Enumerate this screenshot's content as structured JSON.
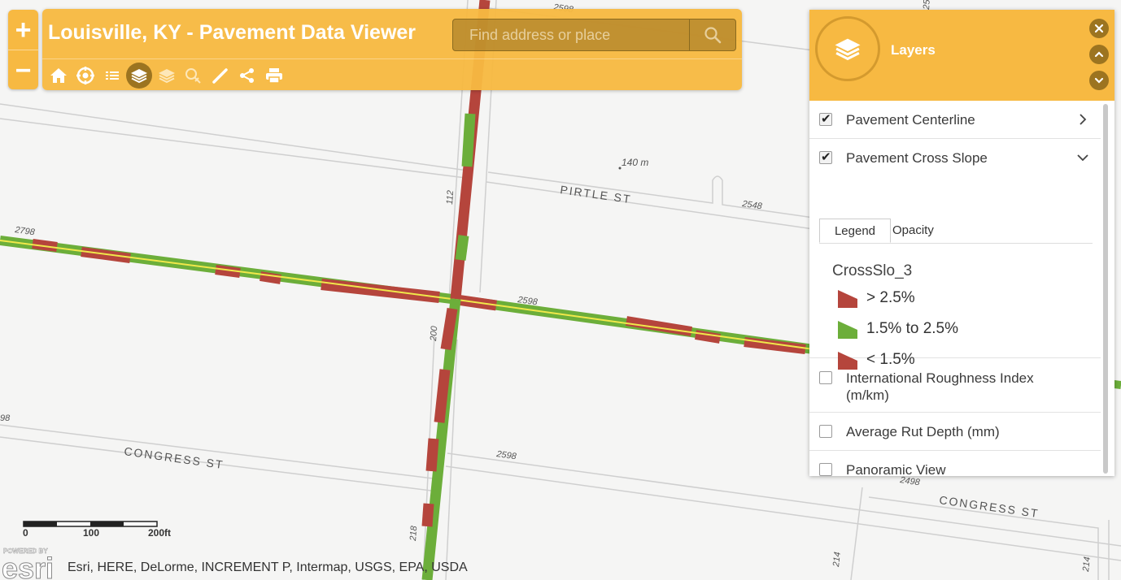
{
  "header": {
    "title": "Louisville, KY - Pavement Data Viewer",
    "search_placeholder": "Find address or place"
  },
  "zoom": {
    "in_label": "+",
    "out_label": "−"
  },
  "toolbar": {
    "tools": [
      "home-icon",
      "locate-icon",
      "list-icon",
      "layers-icon",
      "basemap-icon",
      "bookmark-icon",
      "measure-icon",
      "share-icon",
      "print-icon"
    ],
    "active_tool": "layers-icon"
  },
  "layers_panel": {
    "title": "Layers",
    "layers": [
      {
        "label": "Pavement Centerline",
        "checked": true,
        "expanded": false
      },
      {
        "label": "Pavement Cross Slope",
        "checked": true,
        "expanded": true
      },
      {
        "label": "International Roughness Index (m/km)",
        "checked": false,
        "expanded": false
      },
      {
        "label": "Average Rut Depth (mm)",
        "checked": false,
        "expanded": false
      },
      {
        "label": "Panoramic View",
        "checked": false,
        "expanded": false
      }
    ],
    "tabs": [
      "Legend",
      "Opacity"
    ],
    "active_tab": "Legend",
    "legend": {
      "field": "CrossSlo_3",
      "items": [
        {
          "label": "> 2.5%",
          "color": "#b5453c"
        },
        {
          "label": "1.5% to 2.5%",
          "color": "#6cae3a"
        },
        {
          "label": "< 1.5%",
          "color": "#b5453c"
        }
      ]
    }
  },
  "map": {
    "street_labels": [
      "PIRTLE ST",
      "CONGRESS ST",
      "CONGRESS ST"
    ],
    "address_labels": [
      "2798",
      "2598",
      "2548",
      "2598",
      "2598",
      "2498",
      "112",
      "200",
      "218",
      "214",
      "214",
      "98",
      "2598"
    ],
    "distance_label": "140 m",
    "colors": {
      "high": "#b5453c",
      "mid": "#6cae3a",
      "centerline": "#f0e84a",
      "accent": "#f7b942"
    }
  },
  "scalebar": {
    "labels": [
      "0",
      "100",
      "200ft"
    ]
  },
  "attribution": {
    "powered_by": "POWERED BY",
    "brand": "esri",
    "text": "Esri, HERE, DeLorme, INCREMENT P, Intermap, USGS, EPA, USDA"
  }
}
